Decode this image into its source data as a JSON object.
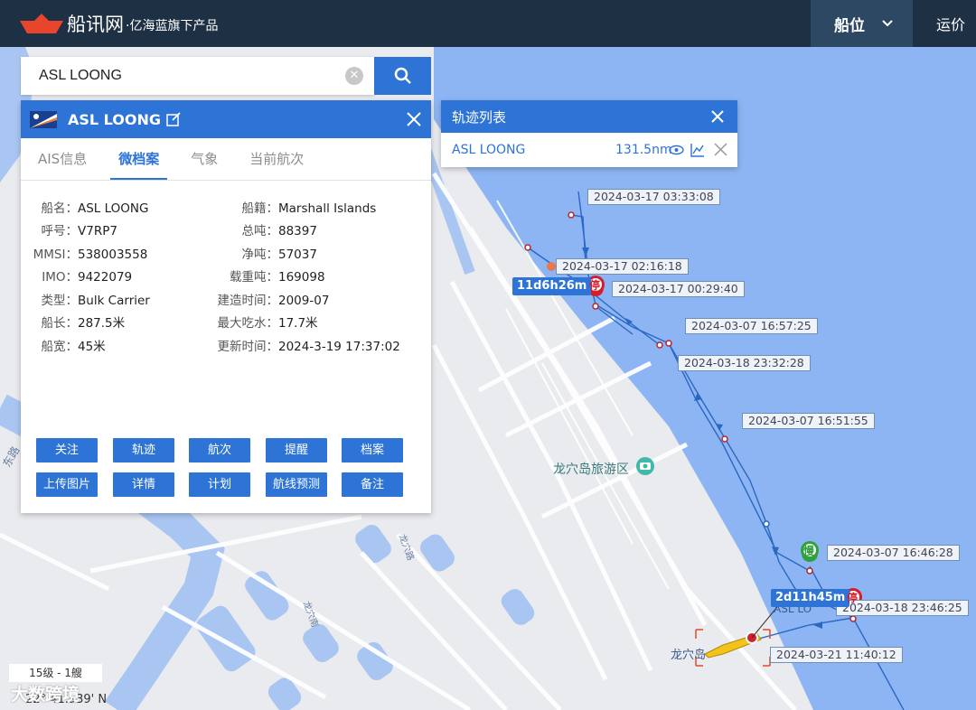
{
  "header": {
    "logo_text": "船讯网",
    "logo_sub": "·亿海蓝旗下产品",
    "nav_active": "船位",
    "nav_next": "运价"
  },
  "search": {
    "value": "ASL LOONG",
    "placeholder": ""
  },
  "ship": {
    "name": "ASL LOONG",
    "tabs": [
      {
        "label": "AIS信息"
      },
      {
        "label": "微档案"
      },
      {
        "label": "气象"
      },
      {
        "label": "当前航次"
      }
    ],
    "left_fields": [
      {
        "label": "船名：",
        "value": "ASL LOONG"
      },
      {
        "label": "呼号：",
        "value": "V7RP7"
      },
      {
        "label": "MMSI：",
        "value": "538003558"
      },
      {
        "label": "IMO：",
        "value": "9422079"
      },
      {
        "label": "类型：",
        "value": "Bulk Carrier"
      },
      {
        "label": "船长：",
        "value": "287.5米"
      },
      {
        "label": "船宽：",
        "value": "45米"
      }
    ],
    "right_fields": [
      {
        "label": "船籍：",
        "value": "Marshall Islands"
      },
      {
        "label": "总吨：",
        "value": "88397"
      },
      {
        "label": "净吨：",
        "value": "57037"
      },
      {
        "label": "载重吨：",
        "value": "169098"
      },
      {
        "label": "建造时间：",
        "value": "2009-07"
      },
      {
        "label": "最大吃水：",
        "value": "17.7米"
      },
      {
        "label": "更新时间：",
        "value": "2024-3-19 17:37:02"
      }
    ],
    "buttons": [
      {
        "label": "关注"
      },
      {
        "label": "轨迹"
      },
      {
        "label": "航次"
      },
      {
        "label": "提醒"
      },
      {
        "label": "档案"
      },
      {
        "label": "上传图片"
      },
      {
        "label": "详情"
      },
      {
        "label": "计划"
      },
      {
        "label": "航线预测"
      },
      {
        "label": "备注"
      }
    ]
  },
  "track_list": {
    "title": "轨迹列表",
    "item_name": "ASL LOONG",
    "item_distance": "131.5nm"
  },
  "map": {
    "time_labels": [
      "2024-03-17 03:33:08",
      "2024-03-17 02:16:18",
      "2024-03-17 00:29:40",
      "2024-03-07 16:57:25",
      "2024-03-18 23:32:28",
      "2024-03-07 16:51:55",
      "2024-03-07 16:46:28",
      "2024-03-18 23:46:25",
      "2024-03-21 11:40:12"
    ],
    "durations": [
      "11d6h26m",
      "2d11h45m"
    ],
    "stop_glyph": "停",
    "slow_glyph": "慢",
    "poi": "龙穴岛旅游区",
    "place": "龙穴岛",
    "ship_label": "ASL LO",
    "road1": "东路",
    "road2": "龙穴路",
    "road3": "龙穴南",
    "scale": "15级 - 1艘",
    "coordinate": "22° 41.939' N",
    "watermark": "大数跨境"
  },
  "colors": {
    "accent": "#2d74d6",
    "header": "#1e3043",
    "sea": "#8db5f3",
    "stop": "#d21f2b",
    "slow": "#2fa13c"
  }
}
